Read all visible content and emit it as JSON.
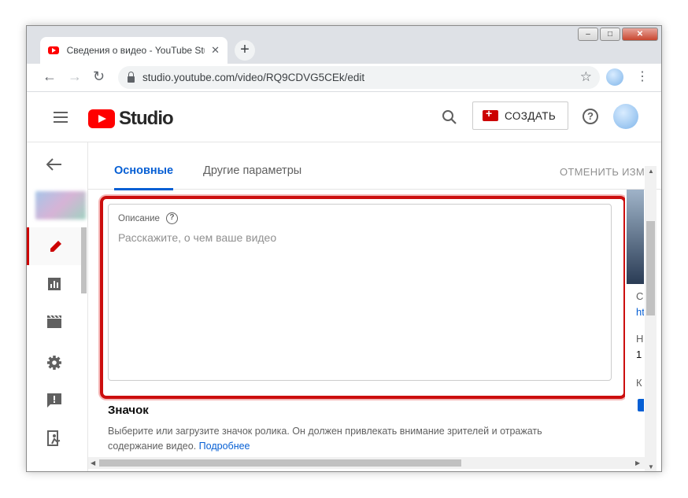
{
  "browser": {
    "tab_title": "Сведения о видео - YouTube Studio",
    "tab_close": "✕",
    "new_tab": "+",
    "url": "studio.youtube.com/video/RQ9CDVG5CEk/edit",
    "back": "←",
    "forward": "→",
    "reload": "↻",
    "star": "☆",
    "menu": "⋮",
    "window_minimize": "–",
    "window_maximize": "□",
    "window_close": "✕"
  },
  "header": {
    "logo_text": "Studio",
    "create_label": "СОЗДАТЬ",
    "help": "?"
  },
  "sidebar": {
    "items": [
      {
        "name": "back-arrow-icon",
        "glyph": "←"
      },
      {
        "name": "edit-pencil-icon",
        "glyph": "✎"
      },
      {
        "name": "analytics-icon",
        "glyph": "▦"
      },
      {
        "name": "editor-clapper-icon",
        "glyph": "🎬"
      },
      {
        "name": "settings-gear-icon",
        "glyph": "⚙"
      },
      {
        "name": "feedback-icon",
        "glyph": "!"
      },
      {
        "name": "exit-icon",
        "glyph": "⇱"
      }
    ]
  },
  "page_tabs": {
    "basic": "Основные",
    "other": "Другие параметры",
    "undo": "ОТМЕНИТЬ ИЗМ"
  },
  "description": {
    "label": "Описание",
    "help": "?",
    "placeholder": "Расскажите, о чем ваше видео"
  },
  "thumbnail_section": {
    "title": "Значок",
    "text": "Выберите или загрузите значок ролика. Он должен привлекать внимание зрителей и отражать содержание видео.",
    "more_link": "Подробнее"
  },
  "right_panel": {
    "c": "С",
    "link": "ht",
    "h": "Н",
    "one": "1",
    "k": "К"
  },
  "colors": {
    "accent_blue": "#065fd4",
    "youtube_red": "#ff0000",
    "highlight_red": "#cc0e0e"
  }
}
